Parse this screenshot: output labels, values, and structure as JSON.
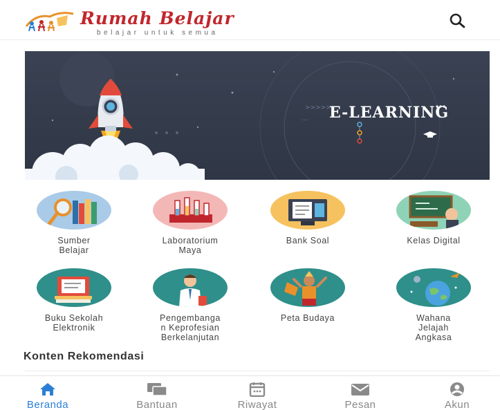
{
  "header": {
    "logo_title": "Rumah Belajar",
    "logo_tagline": "belajar untuk semua",
    "search_icon": "search-icon"
  },
  "banner": {
    "title": "E-LEARNING",
    "illustration": "rocket-launch"
  },
  "menu": [
    {
      "label": "Sumber Belajar",
      "icon": "books-magnifier-icon",
      "color": "#9ec3e6"
    },
    {
      "label": "Laboratorium Maya",
      "icon": "lab-flasks-icon",
      "color": "#f4b6b4"
    },
    {
      "label": "Bank Soal",
      "icon": "monitor-document-icon",
      "color": "#f6c25f"
    },
    {
      "label": "Kelas Digital",
      "icon": "classroom-board-icon",
      "color": "#8fd3b6"
    },
    {
      "label": "Buku Sekolah Elektronik",
      "icon": "ebook-stack-icon",
      "color": "#2f8f8a"
    },
    {
      "label": "Pengembangan Keprofesian Berkelanjutan",
      "icon": "teacher-icon",
      "color": "#2f8f8a"
    },
    {
      "label": "Peta Budaya",
      "icon": "culture-dancer-icon",
      "color": "#2f8f8a"
    },
    {
      "label": "Wahana Jelajah Angkasa",
      "icon": "planet-space-icon",
      "color": "#2f8f8a"
    }
  ],
  "menu_labels_wrapped": [
    "Sumber\nBelajar",
    "Laboratorium\nMaya",
    "Bank Soal",
    "Kelas Digital",
    "Buku Sekolah\nElektronik",
    "Pengembanga\nn Keprofesian\nBerkelanjutan",
    "Peta Budaya",
    "Wahana\nJelajah\nAngkasa"
  ],
  "section": {
    "title": "Konten Rekomendasi"
  },
  "bottom_nav": [
    {
      "label": "Beranda",
      "icon": "home-icon",
      "active": true
    },
    {
      "label": "Bantuan",
      "icon": "chat-icon",
      "active": false
    },
    {
      "label": "Riwayat",
      "icon": "calendar-icon",
      "active": false
    },
    {
      "label": "Pesan",
      "icon": "mail-icon",
      "active": false
    },
    {
      "label": "Akun",
      "icon": "account-icon",
      "active": false
    }
  ],
  "colors": {
    "brand_red": "#c0272d",
    "nav_active": "#2a7fd4",
    "banner_bg": "#343b4b"
  }
}
